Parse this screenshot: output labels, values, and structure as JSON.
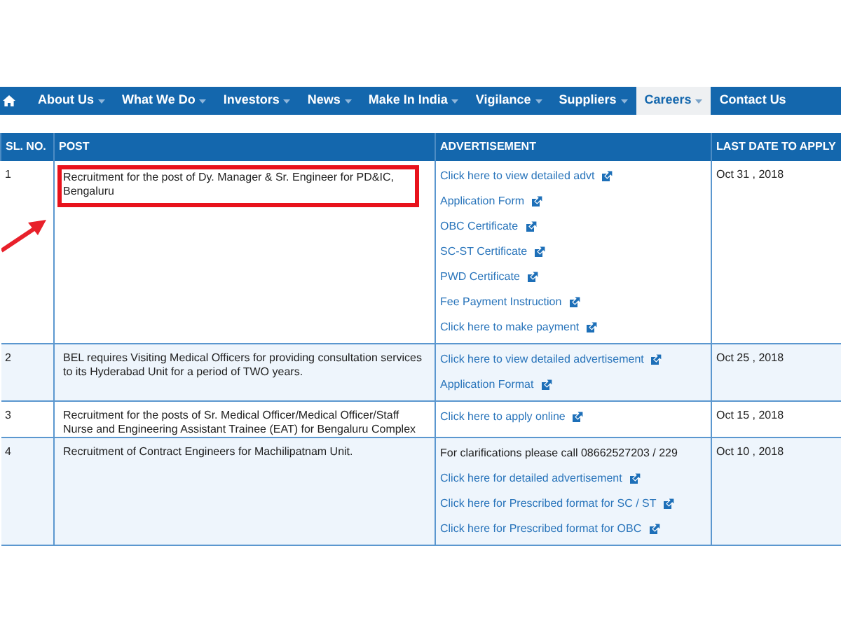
{
  "nav": {
    "items": [
      {
        "label": "About Us",
        "selected": false
      },
      {
        "label": "What We Do",
        "selected": false
      },
      {
        "label": "Investors",
        "selected": false
      },
      {
        "label": "News",
        "selected": false
      },
      {
        "label": "Make In India",
        "selected": false
      },
      {
        "label": "Vigilance",
        "selected": false
      },
      {
        "label": "Suppliers",
        "selected": false
      },
      {
        "label": "Careers",
        "selected": true
      },
      {
        "label": "Contact Us",
        "selected": false
      }
    ]
  },
  "table": {
    "columns": [
      "SL. NO.",
      "POST",
      "ADVERTISEMENT",
      "LAST DATE TO APPLY"
    ],
    "rows": [
      {
        "number": "1",
        "post": "Recruitment for the post of Dy. Manager & Sr. Engineer for PD&IC, Bengaluru",
        "highlighted": true,
        "advertisement": [
          {
            "kind": "link",
            "text": "Click here to view detailed advt"
          },
          {
            "kind": "link",
            "text": "Application Form"
          },
          {
            "kind": "link",
            "text": "OBC Certificate"
          },
          {
            "kind": "link",
            "text": "SC-ST Certificate"
          },
          {
            "kind": "link",
            "text": "PWD Certificate"
          },
          {
            "kind": "link",
            "text": "Fee Payment Instruction"
          },
          {
            "kind": "link",
            "text": "Click here to make payment"
          }
        ],
        "last_date": "Oct 31 , 2018"
      },
      {
        "number": "2",
        "post": "BEL requires Visiting Medical Officers for providing consultation services to its Hyderabad Unit for a period of TWO years.",
        "highlighted": false,
        "advertisement": [
          {
            "kind": "link",
            "text": "Click here to view detailed advertisement"
          },
          {
            "kind": "link",
            "text": "Application Format"
          }
        ],
        "last_date": "Oct 25 , 2018"
      },
      {
        "number": "3",
        "post": "Recruitment for the posts of Sr. Medical Officer/Medical Officer/Staff Nurse and Engineering Assistant Trainee (EAT) for Bengaluru Complex",
        "highlighted": false,
        "advertisement": [
          {
            "kind": "link",
            "text": "Click here to apply online"
          }
        ],
        "last_date": "Oct 15 , 2018"
      },
      {
        "number": "4",
        "post": "Recruitment of Contract Engineers for Machilipatnam Unit.",
        "highlighted": false,
        "advertisement": [
          {
            "kind": "text",
            "text": "For clarifications please call 08662527203 / 229"
          },
          {
            "kind": "link",
            "text": "Click here for detailed advertisement"
          },
          {
            "kind": "link",
            "text": "Click here for Prescribed format for SC / ST"
          },
          {
            "kind": "link",
            "text": "Click here for Prescribed format for OBC"
          }
        ],
        "last_date": "Oct 10 , 2018"
      }
    ]
  }
}
